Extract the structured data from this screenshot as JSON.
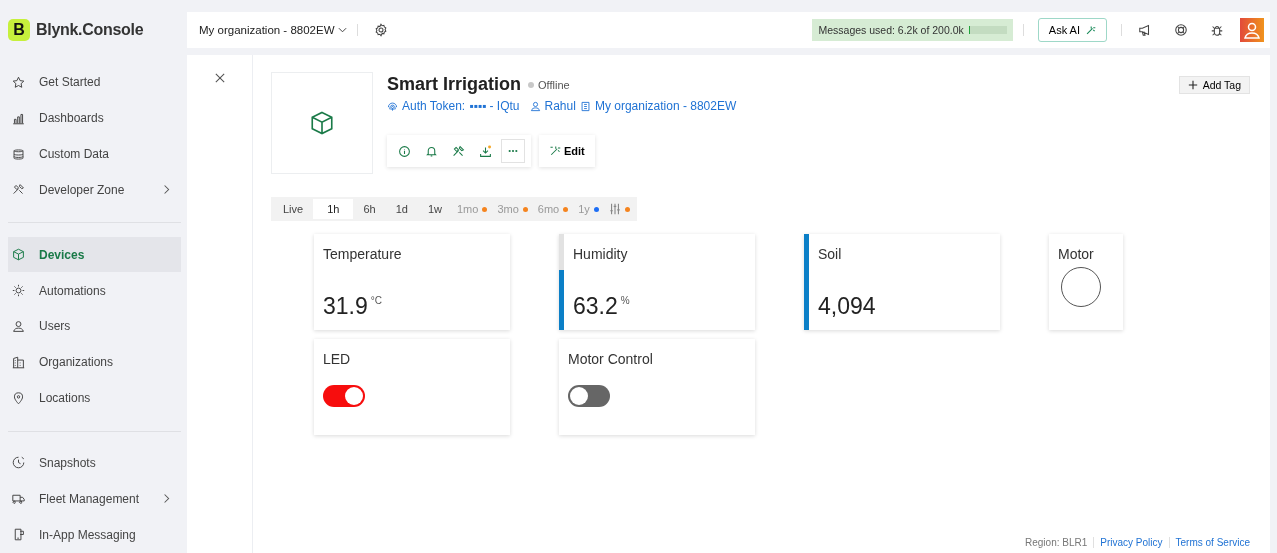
{
  "brand": {
    "logo_letter": "B",
    "name": "Blynk.Console"
  },
  "sidebar": {
    "sections": [
      [
        {
          "label": "Get Started",
          "selected": false,
          "expandable": false
        },
        {
          "label": "Dashboards",
          "selected": false,
          "expandable": false
        },
        {
          "label": "Custom Data",
          "selected": false,
          "expandable": false
        },
        {
          "label": "Developer Zone",
          "selected": false,
          "expandable": true
        }
      ],
      [
        {
          "label": "Devices",
          "selected": true,
          "expandable": false
        },
        {
          "label": "Automations",
          "selected": false,
          "expandable": false
        },
        {
          "label": "Users",
          "selected": false,
          "expandable": false
        },
        {
          "label": "Organizations",
          "selected": false,
          "expandable": false
        },
        {
          "label": "Locations",
          "selected": false,
          "expandable": false
        }
      ],
      [
        {
          "label": "Snapshots",
          "selected": false,
          "expandable": false
        },
        {
          "label": "Fleet Management",
          "selected": false,
          "expandable": true
        },
        {
          "label": "In-App Messaging",
          "selected": false,
          "expandable": false
        }
      ]
    ]
  },
  "topbar": {
    "organization": "My organization - 8802EW",
    "messages": {
      "text": "Messages used: 6.2k of 200.0k",
      "level": 0.03
    },
    "ask_ai": "Ask AI"
  },
  "device": {
    "name": "Smart Irrigation",
    "status": "Offline",
    "online": false,
    "auth_label": "Auth Token:",
    "auth_value": "▪▪▪▪ - IQtu",
    "owner": "Rahul",
    "organization": "My organization - 8802EW",
    "edit": "Edit",
    "add_tag": "Add Tag"
  },
  "time_ranges": [
    {
      "label": "Live",
      "selected": false,
      "disabled": false
    },
    {
      "label": "1h",
      "selected": true,
      "disabled": false
    },
    {
      "label": "6h",
      "selected": false,
      "disabled": false
    },
    {
      "label": "1d",
      "selected": false,
      "disabled": false
    },
    {
      "label": "1w",
      "selected": false,
      "disabled": false
    },
    {
      "label": "1mo",
      "selected": false,
      "disabled": true,
      "color": "#f5841f"
    },
    {
      "label": "3mo",
      "selected": false,
      "disabled": true,
      "color": "#f5841f"
    },
    {
      "label": "6mo",
      "selected": false,
      "disabled": true,
      "color": "#f5841f"
    },
    {
      "label": "1y",
      "selected": false,
      "disabled": true,
      "color": "#1d6ef5"
    },
    {
      "kind": "filter",
      "selected": false,
      "disabled": true,
      "color": "#f5841f"
    }
  ],
  "widgets": [
    [
      {
        "kind": "value",
        "title": "Temperature",
        "value": "31.9",
        "unit": "°C"
      },
      {
        "kind": "value",
        "title": "Humidity",
        "value": "63.2",
        "unit": "%",
        "level": 0.63
      },
      {
        "kind": "value",
        "title": "Soil",
        "value": "4,094",
        "level": 1
      },
      {
        "kind": "led",
        "title": "Motor",
        "on": false
      }
    ],
    [
      {
        "kind": "switch",
        "title": "LED",
        "on": true
      },
      {
        "kind": "switch",
        "title": "Motor Control",
        "on": false
      }
    ]
  ],
  "footer": {
    "region": "Region: BLR1",
    "links": [
      "Privacy Policy",
      "Terms of Service"
    ]
  }
}
